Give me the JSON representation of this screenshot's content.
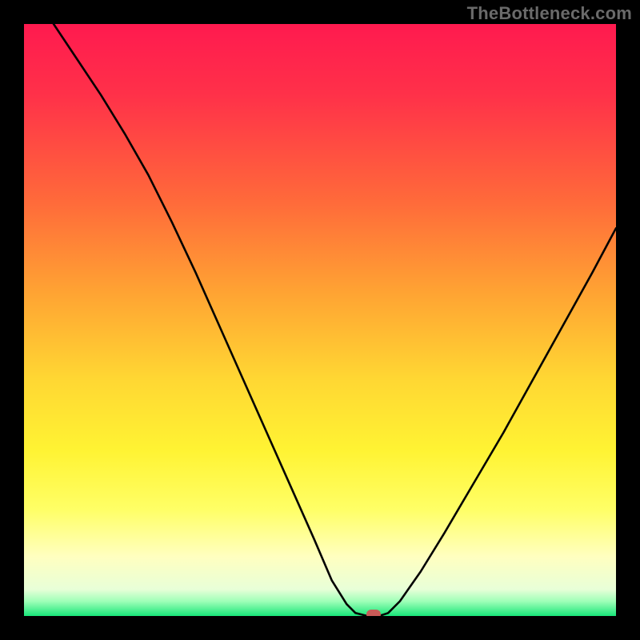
{
  "watermark": "TheBottleneck.com",
  "colors": {
    "black": "#000000",
    "stops": [
      {
        "pos": 0.0,
        "hex": "#ff1a4f"
      },
      {
        "pos": 0.12,
        "hex": "#ff3149"
      },
      {
        "pos": 0.3,
        "hex": "#ff6a3a"
      },
      {
        "pos": 0.45,
        "hex": "#ffa233"
      },
      {
        "pos": 0.6,
        "hex": "#ffd733"
      },
      {
        "pos": 0.72,
        "hex": "#fff333"
      },
      {
        "pos": 0.82,
        "hex": "#ffff66"
      },
      {
        "pos": 0.9,
        "hex": "#ffffc0"
      },
      {
        "pos": 0.955,
        "hex": "#e8ffd8"
      },
      {
        "pos": 0.975,
        "hex": "#9fffb8"
      },
      {
        "pos": 1.0,
        "hex": "#18e679"
      }
    ],
    "curve": "#000000",
    "marker": "#c95b58"
  },
  "chart_data": {
    "type": "line",
    "title": "",
    "xlabel": "",
    "ylabel": "",
    "xlim": [
      0,
      1
    ],
    "ylim": [
      0,
      1
    ],
    "grid": false,
    "legend": false,
    "series": [
      {
        "name": "bottleneck-curve",
        "points": [
          {
            "x": 0.05,
            "y": 1.0
          },
          {
            "x": 0.09,
            "y": 0.94
          },
          {
            "x": 0.13,
            "y": 0.88
          },
          {
            "x": 0.17,
            "y": 0.815
          },
          {
            "x": 0.21,
            "y": 0.745
          },
          {
            "x": 0.25,
            "y": 0.665
          },
          {
            "x": 0.29,
            "y": 0.58
          },
          {
            "x": 0.33,
            "y": 0.49
          },
          {
            "x": 0.37,
            "y": 0.4
          },
          {
            "x": 0.41,
            "y": 0.31
          },
          {
            "x": 0.45,
            "y": 0.22
          },
          {
            "x": 0.49,
            "y": 0.13
          },
          {
            "x": 0.52,
            "y": 0.06
          },
          {
            "x": 0.545,
            "y": 0.02
          },
          {
            "x": 0.56,
            "y": 0.005
          },
          {
            "x": 0.58,
            "y": 0.0
          },
          {
            "x": 0.6,
            "y": 0.0
          },
          {
            "x": 0.615,
            "y": 0.005
          },
          {
            "x": 0.635,
            "y": 0.025
          },
          {
            "x": 0.67,
            "y": 0.075
          },
          {
            "x": 0.71,
            "y": 0.14
          },
          {
            "x": 0.76,
            "y": 0.225
          },
          {
            "x": 0.81,
            "y": 0.31
          },
          {
            "x": 0.86,
            "y": 0.4
          },
          {
            "x": 0.91,
            "y": 0.49
          },
          {
            "x": 0.96,
            "y": 0.58
          },
          {
            "x": 1.0,
            "y": 0.655
          }
        ]
      }
    ],
    "annotations": [
      {
        "name": "min-point",
        "x": 0.59,
        "y": 0.0
      }
    ]
  }
}
